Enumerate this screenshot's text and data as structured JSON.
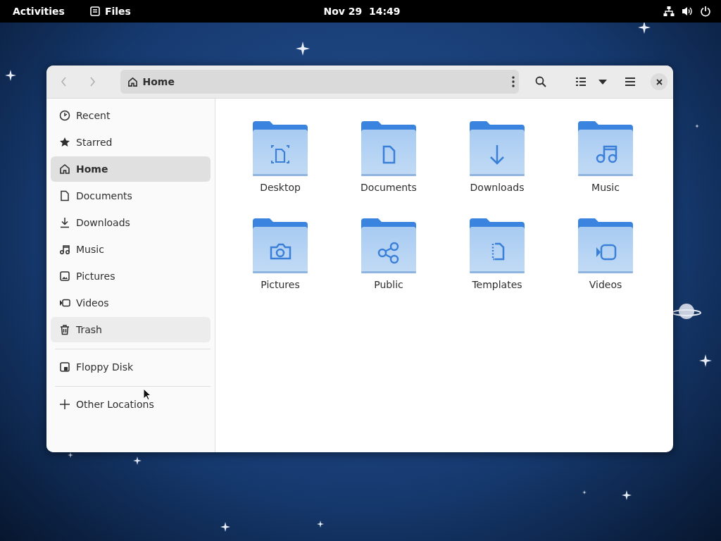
{
  "top_bar": {
    "activities": "Activities",
    "app": "Files",
    "clock": "Nov 29  14:49"
  },
  "window": {
    "path": "Home"
  },
  "sidebar": {
    "sections": [
      [
        {
          "label": "Recent",
          "selected": false,
          "highlighted": false
        },
        {
          "label": "Starred",
          "selected": false,
          "highlighted": false
        },
        {
          "label": "Home",
          "selected": true,
          "highlighted": false
        },
        {
          "label": "Documents",
          "selected": false,
          "highlighted": false
        },
        {
          "label": "Downloads",
          "selected": false,
          "highlighted": false
        },
        {
          "label": "Music",
          "selected": false,
          "highlighted": false
        },
        {
          "label": "Pictures",
          "selected": false,
          "highlighted": false
        },
        {
          "label": "Videos",
          "selected": false,
          "highlighted": false
        },
        {
          "label": "Trash",
          "selected": false,
          "highlighted": true
        }
      ],
      [
        {
          "label": "Floppy Disk",
          "selected": false,
          "highlighted": false
        }
      ],
      [
        {
          "label": "Other Locations",
          "selected": false,
          "highlighted": false
        }
      ]
    ]
  },
  "folders": [
    {
      "name": "Desktop"
    },
    {
      "name": "Documents"
    },
    {
      "name": "Downloads"
    },
    {
      "name": "Music"
    },
    {
      "name": "Pictures"
    },
    {
      "name": "Public"
    },
    {
      "name": "Templates"
    },
    {
      "name": "Videos"
    }
  ]
}
